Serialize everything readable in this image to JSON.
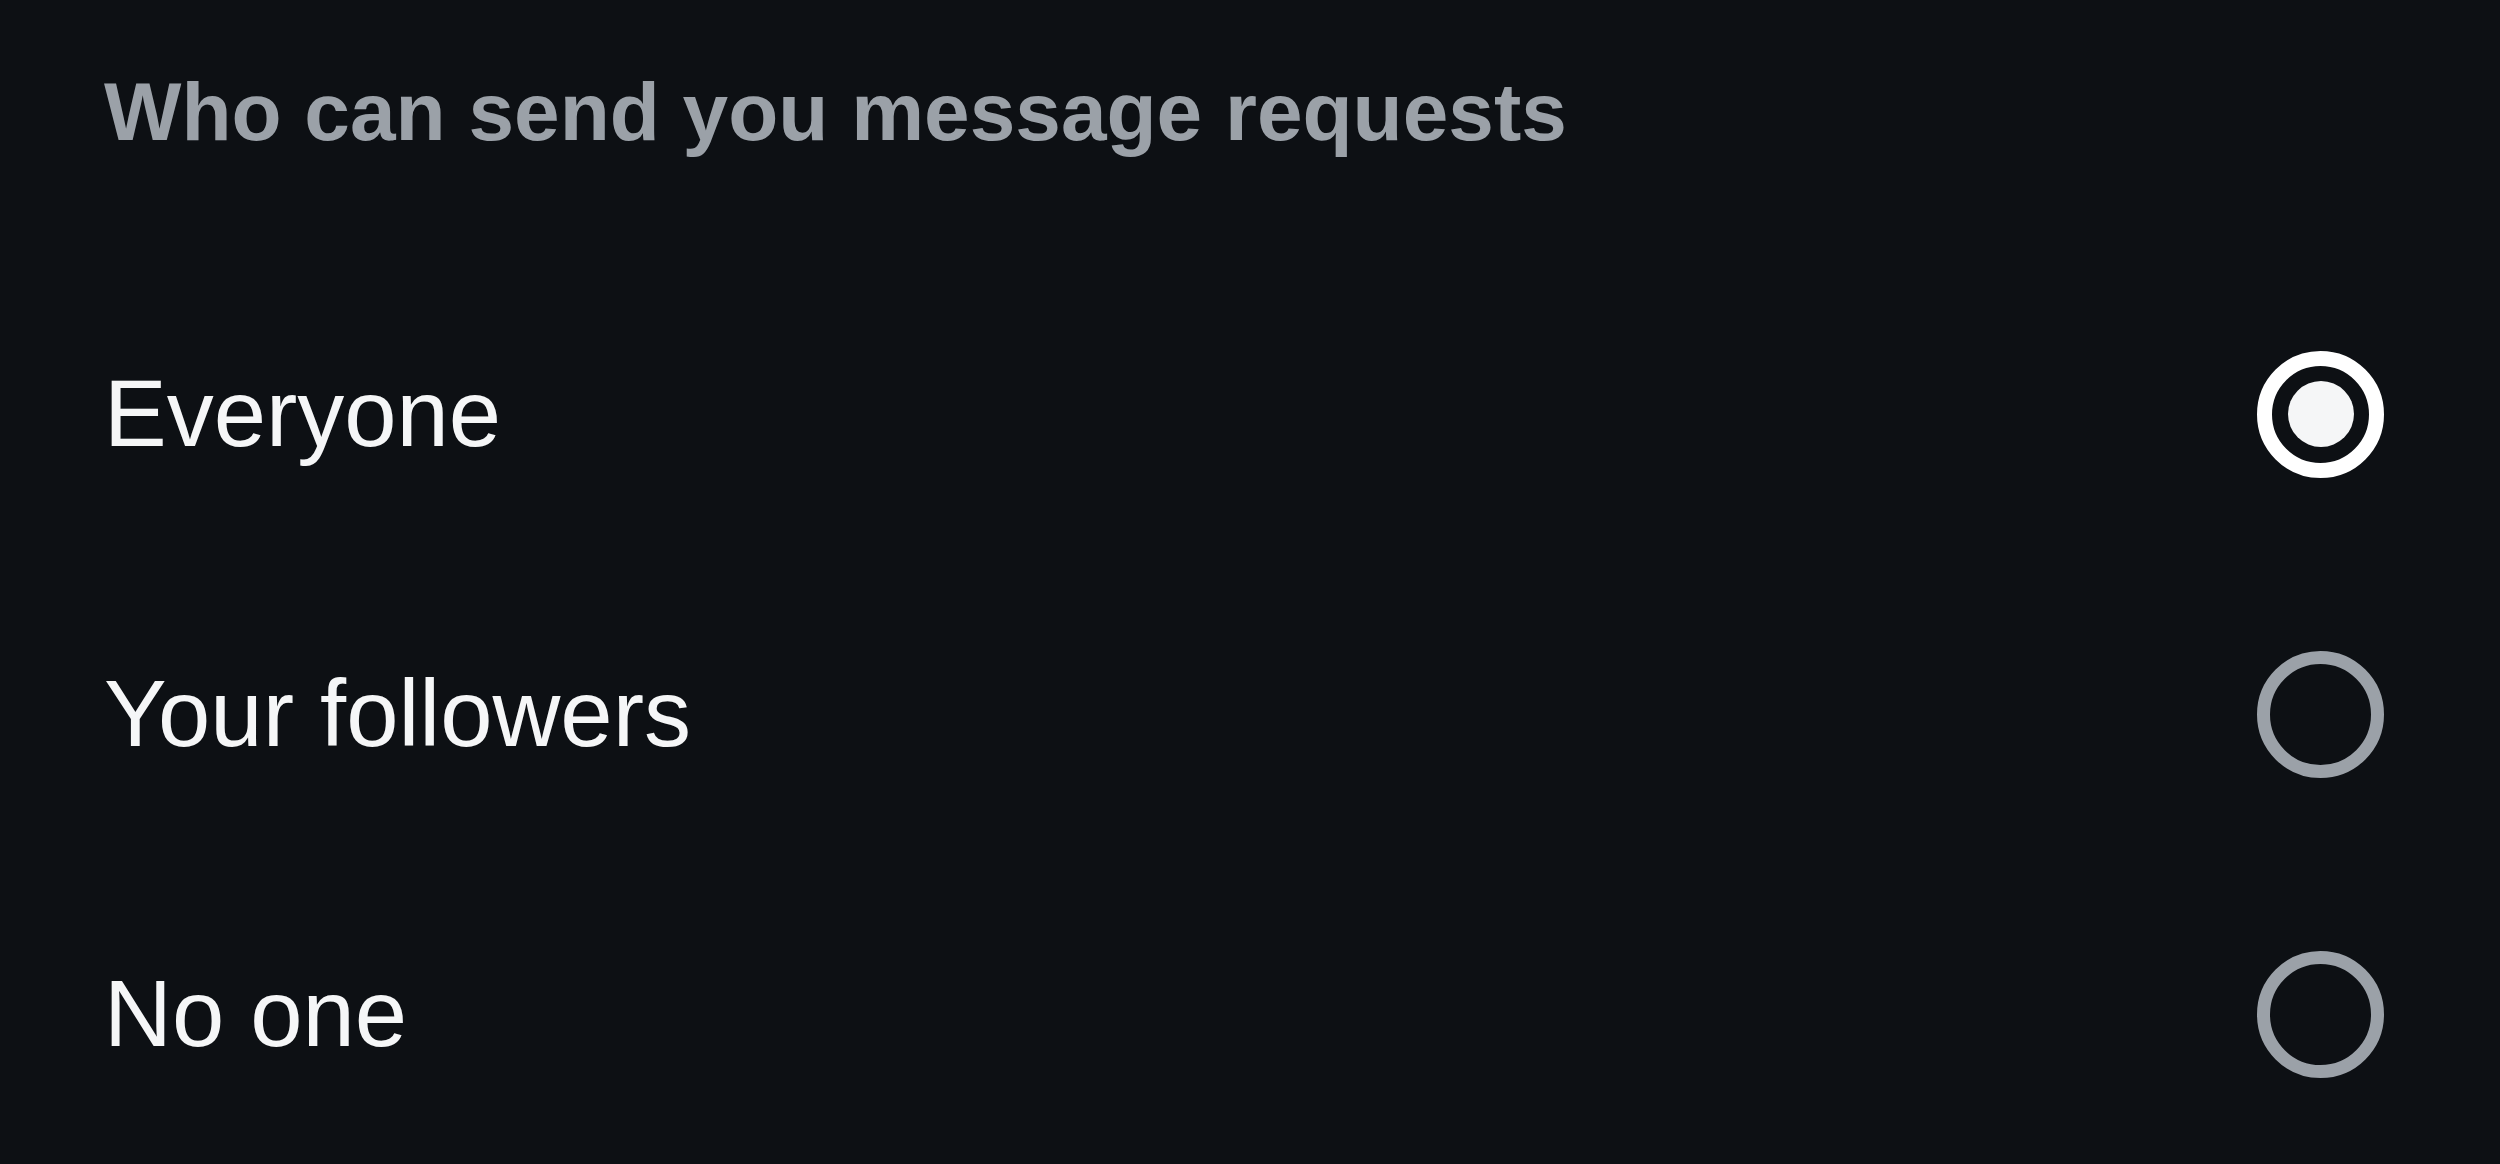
{
  "section_title": "Who can send you message requests",
  "options": [
    {
      "label": "Everyone",
      "selected": true
    },
    {
      "label": "Your followers",
      "selected": false
    },
    {
      "label": "No one",
      "selected": false
    }
  ]
}
